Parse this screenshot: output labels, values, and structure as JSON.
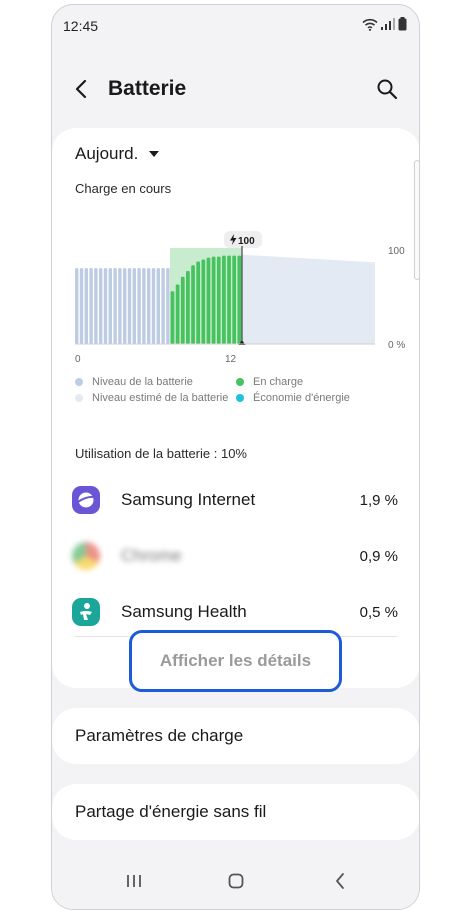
{
  "status_bar": {
    "time": "12:45"
  },
  "header": {
    "title": "Batterie"
  },
  "period": {
    "label": "Aujourd."
  },
  "charge_status": "Charge en cours",
  "chart_data": {
    "type": "bar",
    "x_tick_labels": [
      "0",
      "12"
    ],
    "y_tick_labels": [
      "100",
      "0 %"
    ],
    "ylim": [
      0,
      100
    ],
    "badge_label": "100",
    "bars_battery_level": [
      79,
      79,
      79,
      79,
      79,
      79,
      79,
      79,
      79,
      79,
      79,
      79,
      79,
      79,
      79,
      79,
      79,
      79,
      79,
      79
    ],
    "bars_charging": [
      55,
      62,
      70,
      76,
      82,
      86,
      88,
      90,
      91,
      91,
      92,
      92,
      92,
      92
    ],
    "estimated_level_start": 93,
    "estimated_level_end": 85,
    "colors": {
      "battery_level": "#bccce3",
      "estimated_level": "#e4eaf3",
      "charging": "#46c25e",
      "charging_light": "#c9ecd0",
      "power_saving": "#1cc3d9"
    }
  },
  "legend": [
    {
      "label": "Niveau de la batterie",
      "color": "#bccce3"
    },
    {
      "label": "En charge",
      "color": "#46c25e"
    },
    {
      "label": "Niveau estimé de la batterie",
      "color": "#e4eaf3"
    },
    {
      "label": "Économie d'énergie",
      "color": "#1cc3d9"
    }
  ],
  "usage": {
    "label": "Utilisation de la batterie : 10%",
    "apps": [
      {
        "name": "Samsung Internet",
        "percent": "1,9 %"
      },
      {
        "name": "Chrome",
        "percent": "0,9 %"
      },
      {
        "name": "Samsung Health",
        "percent": "0,5 %"
      }
    ]
  },
  "details_button": "Afficher les détails",
  "menu": {
    "charge_settings": "Paramètres de charge",
    "wireless_sharing": "Partage d'énergie sans fil"
  }
}
